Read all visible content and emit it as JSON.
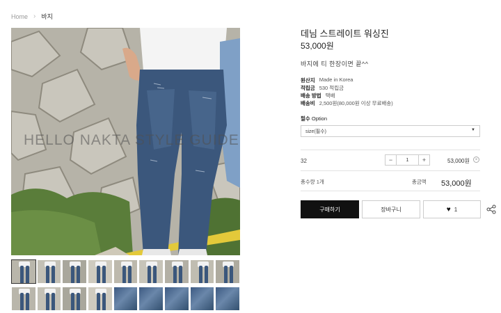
{
  "breadcrumb": {
    "home": "Home",
    "separator": "›",
    "current": "바지"
  },
  "product": {
    "title": "데님 스트레이트 워싱진",
    "price": "53,000원",
    "description": "바지에 티 한장이면 끝^^",
    "watermark": "HELLO NAKTA STYLE GUIDE",
    "specs": [
      {
        "key": "원산지",
        "value": "Made in Korea"
      },
      {
        "key": "적립금",
        "value": "530 적립금"
      },
      {
        "key": "배송 방법",
        "value": "택배"
      },
      {
        "key": "배송비",
        "value": "2,500원(80,000원 이상 무료배송)"
      }
    ]
  },
  "option": {
    "label": "필수",
    "label_suffix": "Option",
    "select_value": "size(필수)"
  },
  "selected_item": {
    "name": "32",
    "minus": "−",
    "quantity": "1",
    "plus": "+",
    "price": "53,000원",
    "remove": "×"
  },
  "summary": {
    "count_label": "총수량 1개",
    "total_label": "총금액",
    "total_price": "53,000원"
  },
  "actions": {
    "buy_label": "구매하기",
    "cart_label": "장바구니",
    "like_count": "1"
  },
  "thumbnails_count": 18,
  "colors": {
    "denim": "#3b577c",
    "buy_bg": "#111111",
    "border": "#cccccc"
  }
}
